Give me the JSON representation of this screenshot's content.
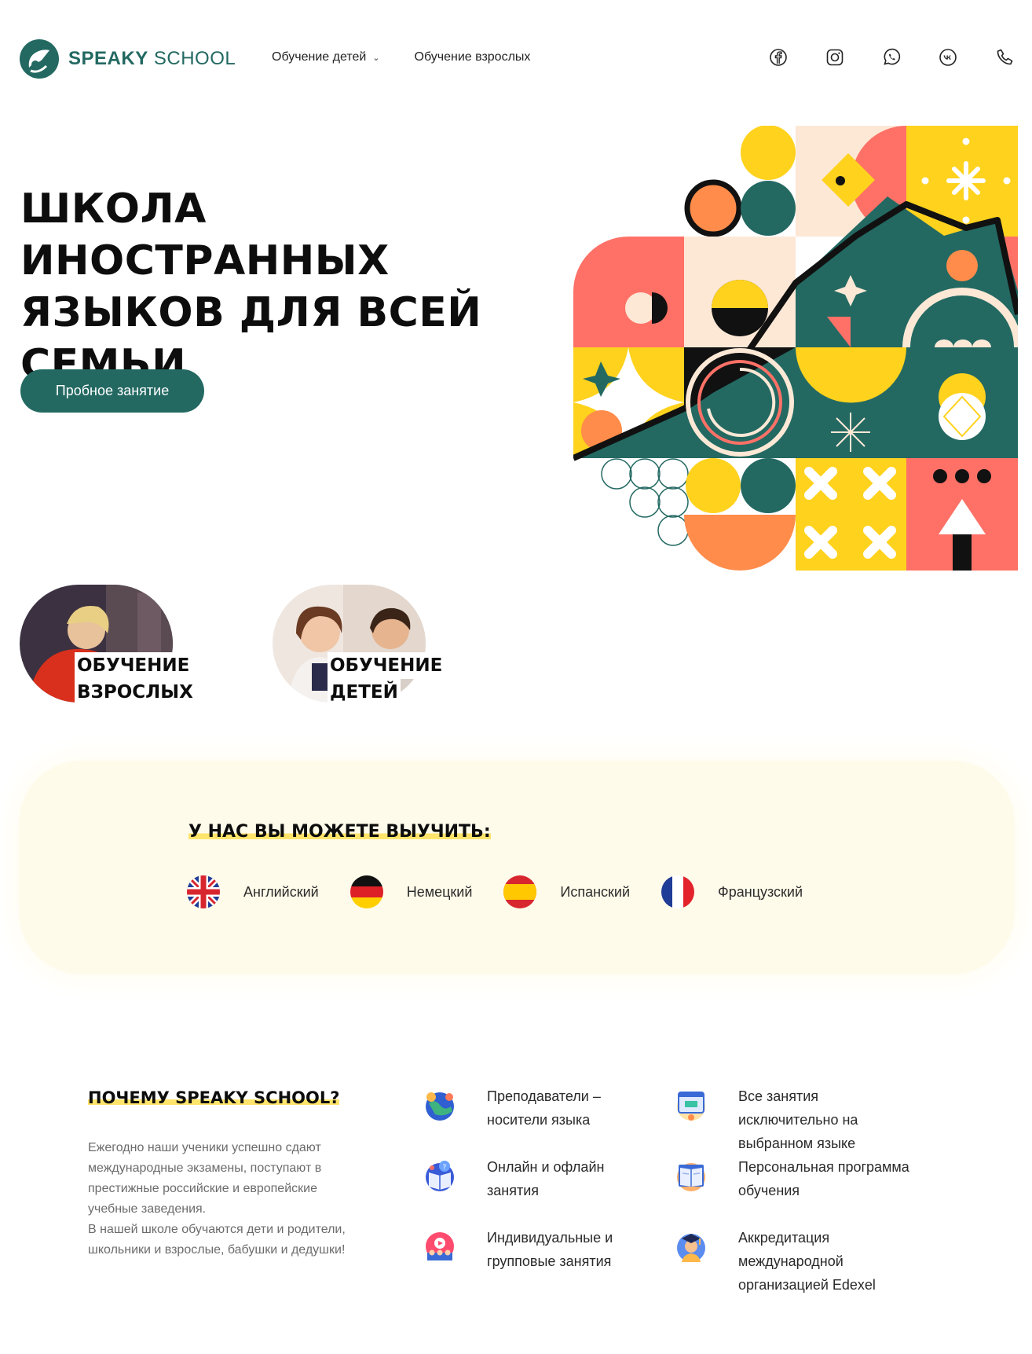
{
  "header": {
    "logo_bold": "SPEAKY",
    "logo_light": "SCHOOL",
    "nav": [
      {
        "label": "Обучение детей",
        "has_dropdown": true
      },
      {
        "label": "Обучение взрослых",
        "has_dropdown": false
      }
    ],
    "socials": [
      "facebook-icon",
      "instagram-icon",
      "whatsapp-icon",
      "vk-icon",
      "phone-icon"
    ]
  },
  "hero": {
    "title": "ШКОЛА ИНОСТРАННЫХ ЯЗЫКОВ ДЛЯ ВСЕЙ СЕМЬИ",
    "cta": "Пробное занятие"
  },
  "cards": {
    "adults": {
      "line1": "ОБУЧЕНИЕ",
      "line2": "ВЗРОСЛЫХ"
    },
    "kids": {
      "line1": "ОБУЧЕНИЕ",
      "line2": "ДЕТЕЙ"
    }
  },
  "languages": {
    "title": "У НАС ВЫ МОЖЕТЕ ВЫУЧИТЬ:",
    "items": [
      {
        "name": "Английский",
        "flag": "uk-flag-icon"
      },
      {
        "name": "Немецкий",
        "flag": "germany-flag-icon"
      },
      {
        "name": "Испанский",
        "flag": "spain-flag-icon"
      },
      {
        "name": "Французский",
        "flag": "france-flag-icon"
      }
    ]
  },
  "why": {
    "title": "ПОЧЕМУ SPEAKY SCHOOL?",
    "paragraph1": "Ежегодно наши ученики успешно сдают международные экзамены, поступают в престижные российские и европейские учебные заведения.",
    "paragraph2": "В нашей школе обучаются дети и родители, школьники и взрослые, бабушки и дедушки!",
    "features": [
      {
        "text": "Преподаватели – носители языка",
        "icon": "globe-teacher-icon"
      },
      {
        "text": "Все занятия исключительно на выбранном языке",
        "icon": "browser-lesson-icon"
      },
      {
        "text": "Онлайн и офлайн занятия",
        "icon": "book-question-icon"
      },
      {
        "text": "Персональная программа обучения",
        "icon": "program-book-icon"
      },
      {
        "text": "Индивидуальные и групповые занятия",
        "icon": "video-group-icon"
      },
      {
        "text": "Аккредитация международной организацией Edexel",
        "icon": "graduate-icon"
      }
    ]
  },
  "colors": {
    "brand": "#236962",
    "accent_yellow": "#ffd21e",
    "accent_coral": "#ff7167",
    "accent_orange": "#ff8c4a",
    "panel": "#fffbea"
  }
}
